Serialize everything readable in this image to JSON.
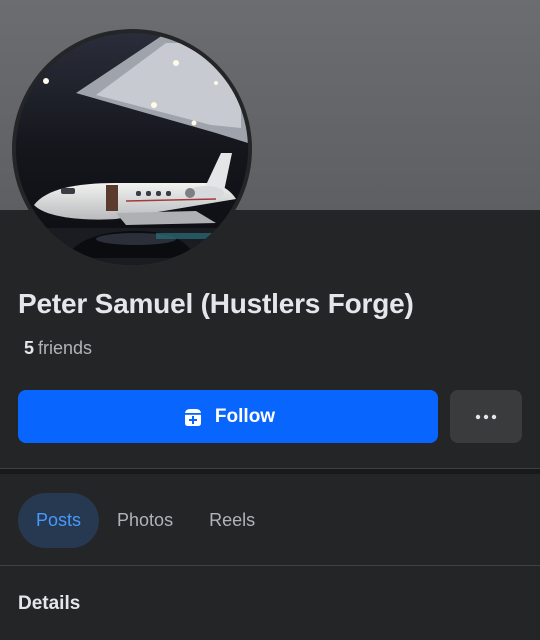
{
  "profile": {
    "name": "Peter Samuel (Hustlers Forge)",
    "friends_count": "5",
    "friends_label": "friends"
  },
  "actions": {
    "follow_label": "Follow",
    "follow_icon": "follow-plus-icon",
    "more_icon": "ellipsis-icon"
  },
  "tabs": [
    {
      "label": "Posts",
      "active": true
    },
    {
      "label": "Photos",
      "active": false
    },
    {
      "label": "Reels",
      "active": false
    }
  ],
  "sections": {
    "details_title": "Details"
  },
  "colors": {
    "background": "#242526",
    "accent": "#0866ff",
    "active_tab_bg": "#263951",
    "active_tab_text": "#4599ff"
  }
}
